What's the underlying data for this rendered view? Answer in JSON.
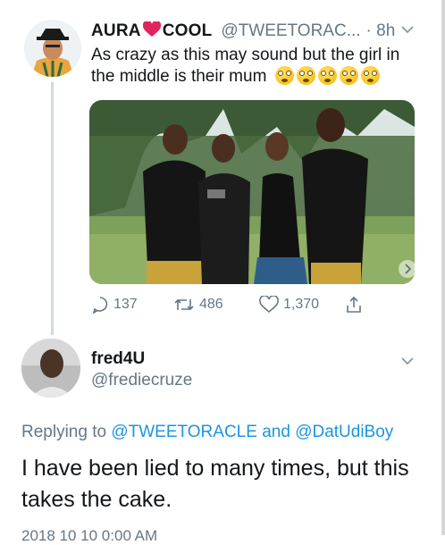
{
  "tweet": {
    "author_name_prefix": "AURA",
    "author_name_suffix": "COOL",
    "handle": "@TWEETORAC...",
    "time": "· 8h",
    "text": "As crazy as this may sound but the girl in the middle is their mum",
    "emoji_count": 5,
    "actions": {
      "replies": "137",
      "retweets": "486",
      "likes": "1,370"
    }
  },
  "reply": {
    "author_name": "fred4U",
    "handle": "@frediecruze",
    "replying_label": "Replying to",
    "mention_1": "@TWEETORACLE",
    "and_label": "and",
    "mention_2": "@DatUdiBoy",
    "text": "I have been lied to many times, but this takes the cake.",
    "timestamp_cut": "2018 10 10 0:00 AM"
  },
  "colors": {
    "link": "#1b95e0",
    "muted": "#657786",
    "text": "#14171a",
    "heart": "#e0245e"
  }
}
